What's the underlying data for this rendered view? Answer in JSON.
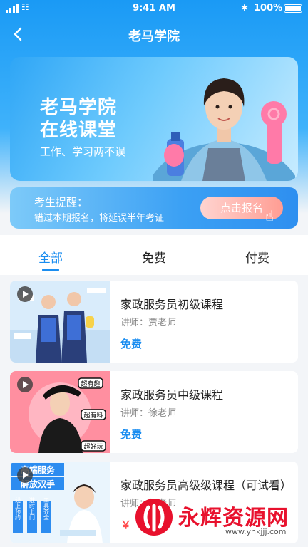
{
  "status_bar": {
    "time": "9:41 AM",
    "battery": "100%"
  },
  "nav": {
    "title": "老马学院"
  },
  "banner": {
    "line1": "老马学院",
    "line2": "在线课堂",
    "subtitle": "工作、学习两不误"
  },
  "reminder": {
    "title": "考生提醒：",
    "text": "错过本期报名，将延误半年考证",
    "button": "点击报名"
  },
  "tabs": [
    {
      "label": "全部",
      "active": true
    },
    {
      "label": "免费",
      "active": false
    },
    {
      "label": "付费",
      "active": false
    }
  ],
  "courses": [
    {
      "title": "家政服务员初级课程",
      "teacher": "讲师：贾老师",
      "price": "免费"
    },
    {
      "title": "家政服务员中级课程",
      "teacher": "讲师：徐老师",
      "price": "免费"
    },
    {
      "title": "家政服务员高级级课程（可试看）",
      "teacher": "讲师：郭老师",
      "price": "￥"
    }
  ],
  "thumb_text": {
    "c2_tag1": "超有趣",
    "c2_tag2": "超有料",
    "c2_tag3": "超好玩",
    "c3_line1": "高端服务",
    "c3_line2": "解放双手",
    "c3_col1": "线上预约",
    "c3_col2": "准时上门",
    "c3_col3": "工具齐全"
  },
  "watermark": {
    "text": "永辉资源网",
    "url": "www.yhkjjj.com"
  },
  "colors": {
    "primary": "#1a8df0",
    "banner_start": "#2fa6f6",
    "signup_pink": "#ff9d93",
    "free": "#1a8df0",
    "watermark_red": "#e8112d"
  }
}
